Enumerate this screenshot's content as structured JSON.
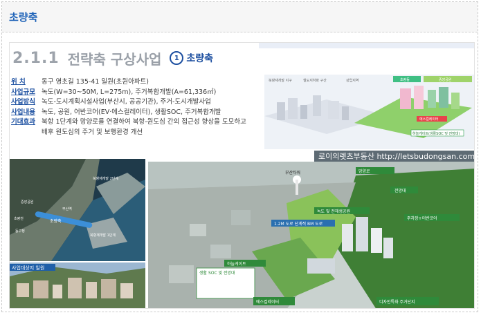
{
  "card": {
    "title": "초량축"
  },
  "slide": {
    "section_number": "2.1.1",
    "section_title": "전략축 구상사업",
    "sub_number": "①",
    "sub_title": "초량축",
    "info": [
      {
        "key": "위      치",
        "value": "동구 영초길 135-41 일원(초원아파트)"
      },
      {
        "key": "사업규모",
        "value": "녹도(W=30~50M, L=275m), 주거복합개발(A=61,336㎡)"
      },
      {
        "key": "사업방식",
        "value": "녹도-도시계획시설사업(부산시, 공공기관), 주거-도시개발사업"
      },
      {
        "key": "사업내용",
        "value": "녹도, 공원, 어반코어(EV·에스컬레이터), 생활SOC, 주거복합개발"
      },
      {
        "key": "기대효과",
        "value": "북항 1단계와 망양로를 연결하여 북항-원도심 간의 접근성 향상을 도모하고"
      },
      {
        "key": "",
        "value": "배후 원도심의 주거 및 보행환경 개선"
      }
    ],
    "watermark": "로이의렛츠부동산 http://letsbudongsan.com",
    "diagram_labels": {
      "top1": "북항재개발 지구",
      "top2": "철도지하화 구간",
      "top3": "상업지역",
      "tag1": "초량동",
      "tag2": "중앙공원",
      "box1": "에스컬레이터",
      "box2": "하늘게이트(생활SOC 및 전망대)"
    },
    "satellite_labels": {
      "l1": "북항재개발 2단계",
      "l2": "중앙공원",
      "l3": "부산역",
      "l4": "초량천",
      "l5": "동구청",
      "l6": "북항재개발 1단계",
      "band": "초량축"
    },
    "city_label": "사업대상지 일원",
    "aerial_labels": {
      "a1": "망양로",
      "a2": "부산타워",
      "a3": "전망대",
      "a4": "녹도 및 전해생공원",
      "a5": "주차장+어반코어",
      "a6": "1.2M 도로 단계적 BM 도로",
      "a7": "하늘게이트",
      "a8": "생활 SOC 및 전망대",
      "a9": "에스컬레이터",
      "a10": "디자인특화 주거단지"
    }
  }
}
